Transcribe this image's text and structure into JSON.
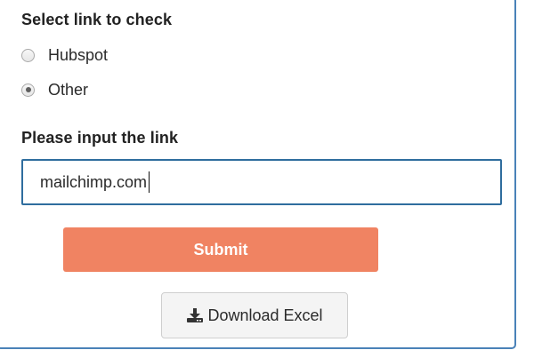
{
  "form": {
    "select_title": "Select link to check",
    "options": [
      {
        "label": "Hubspot",
        "checked": false
      },
      {
        "label": "Other",
        "checked": true
      }
    ],
    "input_title": "Please input the link",
    "link_input_value": "mailchimp.com",
    "submit_label": "Submit",
    "download_label": "Download Excel"
  },
  "icons": {
    "download": "download-icon"
  },
  "colors": {
    "panel_border": "#4a82b8",
    "input_border": "#2f6d9e",
    "submit_bg": "#f08362",
    "download_bg": "#f4f4f4"
  }
}
